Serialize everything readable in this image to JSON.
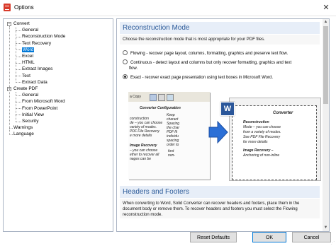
{
  "window": {
    "title": "Options",
    "close_glyph": "✕"
  },
  "tree": {
    "items": [
      {
        "label": "Convert",
        "level": 0,
        "expander": "−"
      },
      {
        "label": "General",
        "level": 1
      },
      {
        "label": "Reconstruction Mode",
        "level": 1
      },
      {
        "label": "Text Recovery",
        "level": 1
      },
      {
        "label": "Word",
        "level": 1,
        "selected": true
      },
      {
        "label": "Excel",
        "level": 1
      },
      {
        "label": "HTML",
        "level": 1
      },
      {
        "label": "Extract Images",
        "level": 1
      },
      {
        "label": "Text",
        "level": 1
      },
      {
        "label": "Extract Data",
        "level": 1
      },
      {
        "label": "Create PDF",
        "level": 0,
        "expander": "−"
      },
      {
        "label": "General",
        "level": 1
      },
      {
        "label": "From Microsoft Word",
        "level": 1
      },
      {
        "label": "From PowerPoint",
        "level": 1
      },
      {
        "label": "Initial View",
        "level": 1
      },
      {
        "label": "Security",
        "level": 1
      },
      {
        "label": "Warnings",
        "level": 0
      },
      {
        "label": "Language",
        "level": 0
      }
    ]
  },
  "reconstruction": {
    "heading": "Reconstruction Mode",
    "description": "Choose the reconstruction mode that is most appropriate for your PDF files.",
    "options": [
      {
        "line1": "Flowing - recover page layout, columns, formatting, graphics and preserve text flow.",
        "line2": "",
        "selected": false
      },
      {
        "line1": "Continuous - detect layout and columns but only recover formatting, graphics and text",
        "line2": "flow.",
        "selected": false
      },
      {
        "line1": "Exact - recover exact page presentation using text boxes in Microsoft Word.",
        "line2": "",
        "selected": true
      }
    ]
  },
  "illustration": {
    "toolbar_text": "a Copy",
    "left_title": "Converter Configuration",
    "left_col1": [
      "construction",
      "de – you can choose",
      "variety of modes.",
      "PDF File Recovery",
      "e more details"
    ],
    "left_col2": [
      "Keep",
      "charact",
      "Spacing",
      "the char",
      "PDF fil",
      "individu",
      "spacing",
      "order to"
    ],
    "left_sub": "Image Recovery",
    "left_sub_text": [
      "– you can choose",
      "ether to recover all",
      "nages can be"
    ],
    "left_col2b": [
      "font",
      "non-"
    ],
    "right_title": "Converter",
    "right_head": "Reconstruction",
    "right_lines": [
      "Mode – you can choose",
      "from a variety of modes.",
      "See PDF File Recovery",
      "for more details"
    ],
    "right_sub": "Image Recovery –",
    "right_sub_text": "Anchoring of non-inline",
    "word_badge": "W",
    "colors": {
      "arrow": "#2b6fd6",
      "word": "#2b579a"
    }
  },
  "headers_footers": {
    "heading": "Headers and Footers",
    "description": "When converting to Word, Solid Converter can recover headers and footers, place them in the document body or remove them. To recover headers and footers you must select the Flowing reconstruction mode."
  },
  "buttons": {
    "reset": "Reset Defaults",
    "ok": "OK",
    "cancel": "Cancel"
  },
  "scroll": {
    "up": "▲",
    "down": "▼"
  }
}
